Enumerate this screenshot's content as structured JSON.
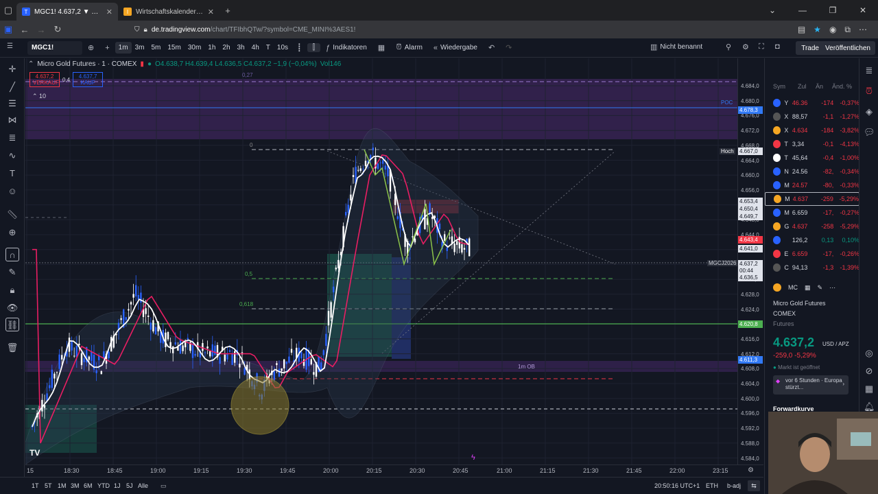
{
  "browser": {
    "tabs": [
      {
        "title": "MGC1! 4.637,2 ▼ −5.29% Nicht",
        "active": true
      },
      {
        "title": "Wirtschaftskalender - Investing",
        "active": false
      }
    ],
    "url_host": "de.tradingview.com",
    "url_path": "/chart/TFIbhQTw/?symbol=CME_MINI%3AES1!"
  },
  "toolbar": {
    "symbol": "MGC1!",
    "timeframes": [
      "1m",
      "3m",
      "5m",
      "15m",
      "30m",
      "1h",
      "2h",
      "3h",
      "4h",
      "T",
      "10s"
    ],
    "active_timeframe": "1m",
    "indicators_label": "Indikatoren",
    "alarm_label": "Alarm",
    "replay_label": "Wiedergabe",
    "layout_name": "Nicht benannt",
    "trade_label": "Trade",
    "publish_label": "Veröffentlichen"
  },
  "legend": {
    "name": "Micro Gold Futures · 1 · COMEX",
    "ohlc": "O4.638,7 H4.639,4 L4.636,5 C4.637,2 −1,9 (−0,04%)",
    "volume": "Vol146",
    "sell_price": "4.637,2",
    "sell_label": "VERKAUF",
    "spread": "0,4",
    "buy_price": "4.637,7",
    "buy_label": "KAUF",
    "counter": "10"
  },
  "chart_labels": {
    "poc": "POC",
    "hoch": "Hoch",
    "fib_0": "0",
    "fib_05": "0,5",
    "fib_0618": "0,618",
    "ob_label": "1m OB",
    "fib_top": "0,27",
    "contract_tag": "MGCJ2026"
  },
  "price_axis": {
    "ticks": [
      "4.684,0",
      "4.680,0",
      "4.676,0",
      "4.672,0",
      "4.668,0",
      "4.664,0",
      "4.660,0",
      "4.656,0",
      "4.652,0",
      "4.648,0",
      "4.644,0",
      "4.640,0",
      "4.636,0",
      "4.632,0",
      "4.628,0",
      "4.624,0",
      "4.620,0",
      "4.616,0",
      "4.612,0",
      "4.608,0",
      "4.604,0",
      "4.600,0",
      "4.596,0",
      "4.592,0",
      "4.588,0",
      "4.584,0"
    ],
    "tags": [
      {
        "text": "4.678,3",
        "color": "#3179f5"
      },
      {
        "text": "4.667,0",
        "color": "#ffffff"
      },
      {
        "text": "4.653,4",
        "color": "#d1d4dc"
      },
      {
        "text": "4.650,4",
        "color": "#d1d4dc"
      },
      {
        "text": "4.649,7",
        "color": "#d1d4dc"
      },
      {
        "text": "4.643,4",
        "color": "#f23645"
      },
      {
        "text": "4.641,0",
        "color": "#ffffff"
      },
      {
        "text": "4.637,2",
        "color": "#ffffff"
      },
      {
        "text": "00:44",
        "color": "#ffffff"
      },
      {
        "text": "4.636,5",
        "color": "#d1d4dc"
      },
      {
        "text": "4.620,8",
        "color": "#4caf50"
      },
      {
        "text": "4.611,3",
        "color": "#3179f5"
      }
    ]
  },
  "time_axis": [
    "15",
    "18:30",
    "18:45",
    "19:00",
    "19:15",
    "19:30",
    "19:45",
    "20:00",
    "20:15",
    "20:30",
    "20:45",
    "21:00",
    "21:15",
    "21:30",
    "21:45",
    "22:00",
    "23:00",
    "23:15"
  ],
  "bottom_bar": {
    "ranges": [
      "1T",
      "5T",
      "1M",
      "3M",
      "6M",
      "YTD",
      "1J",
      "5J",
      "Alle"
    ],
    "clock": "20:50:16 UTC+1",
    "session": "ETH",
    "adj": "b-adj"
  },
  "watchlist": {
    "headers": [
      "Sym",
      "Zul",
      "Än",
      "Änd. %"
    ],
    "rows": [
      {
        "sym": "Y",
        "last": "46.36",
        "chg": "-174",
        "pct": "-0,37%",
        "color": "#2962ff"
      },
      {
        "sym": "X",
        "last": "88,57",
        "chg": "-1,1",
        "pct": "-1,27%",
        "color": "#555"
      },
      {
        "sym": "X",
        "last": "4.634",
        "chg": "-184",
        "pct": "-3,82%",
        "color": "#f5a623"
      },
      {
        "sym": "T",
        "last": "3,34",
        "chg": "-0,1",
        "pct": "-4,13%",
        "color": "#f23645"
      },
      {
        "sym": "T",
        "last": "45,64",
        "chg": "-0,4",
        "pct": "-1,00%",
        "color": "#ffffff"
      },
      {
        "sym": "N",
        "last": "24.56",
        "chg": "-82,",
        "pct": "-0,34%",
        "color": "#2962ff"
      },
      {
        "sym": "M",
        "last": "24.57",
        "chg": "-80,",
        "pct": "-0,33%",
        "color": "#2962ff"
      },
      {
        "sym": "M",
        "last": "4.637",
        "chg": "-259",
        "pct": "-5,29%",
        "color": "#f5a623"
      },
      {
        "sym": "M",
        "last": "6.659",
        "chg": "-17,",
        "pct": "-0,27%",
        "color": "#2962ff"
      },
      {
        "sym": "G",
        "last": "4.637",
        "chg": "-258",
        "pct": "-5,29%",
        "color": "#f5a623"
      },
      {
        "sym": "",
        "last": "126,2",
        "chg": "0,13",
        "pct": "0,10%",
        "color": "#2962ff"
      },
      {
        "sym": "E",
        "last": "6.659",
        "chg": "-17,",
        "pct": "-0,26%",
        "color": "#f23645"
      },
      {
        "sym": "C",
        "last": "94,13",
        "chg": "-1,3",
        "pct": "-1,39%",
        "color": "#555"
      }
    ]
  },
  "detail": {
    "tab": "MC",
    "name": "Micro Gold Futures",
    "exchange": "COMEX",
    "type": "Futures",
    "price": "4.637,2",
    "unit": "USD / APZ",
    "change": "-259,0 -5,29%",
    "market": "Markt ist geöffnet",
    "news": "vor 6 Stunden · Europa stürzt...",
    "forward": "Forwardkurve"
  },
  "colors": {
    "bg": "#131722",
    "up": "#089981",
    "down": "#f23645",
    "accent": "#2962ff",
    "candle_up": "#2962ff",
    "candle_down": "#ffffff"
  }
}
